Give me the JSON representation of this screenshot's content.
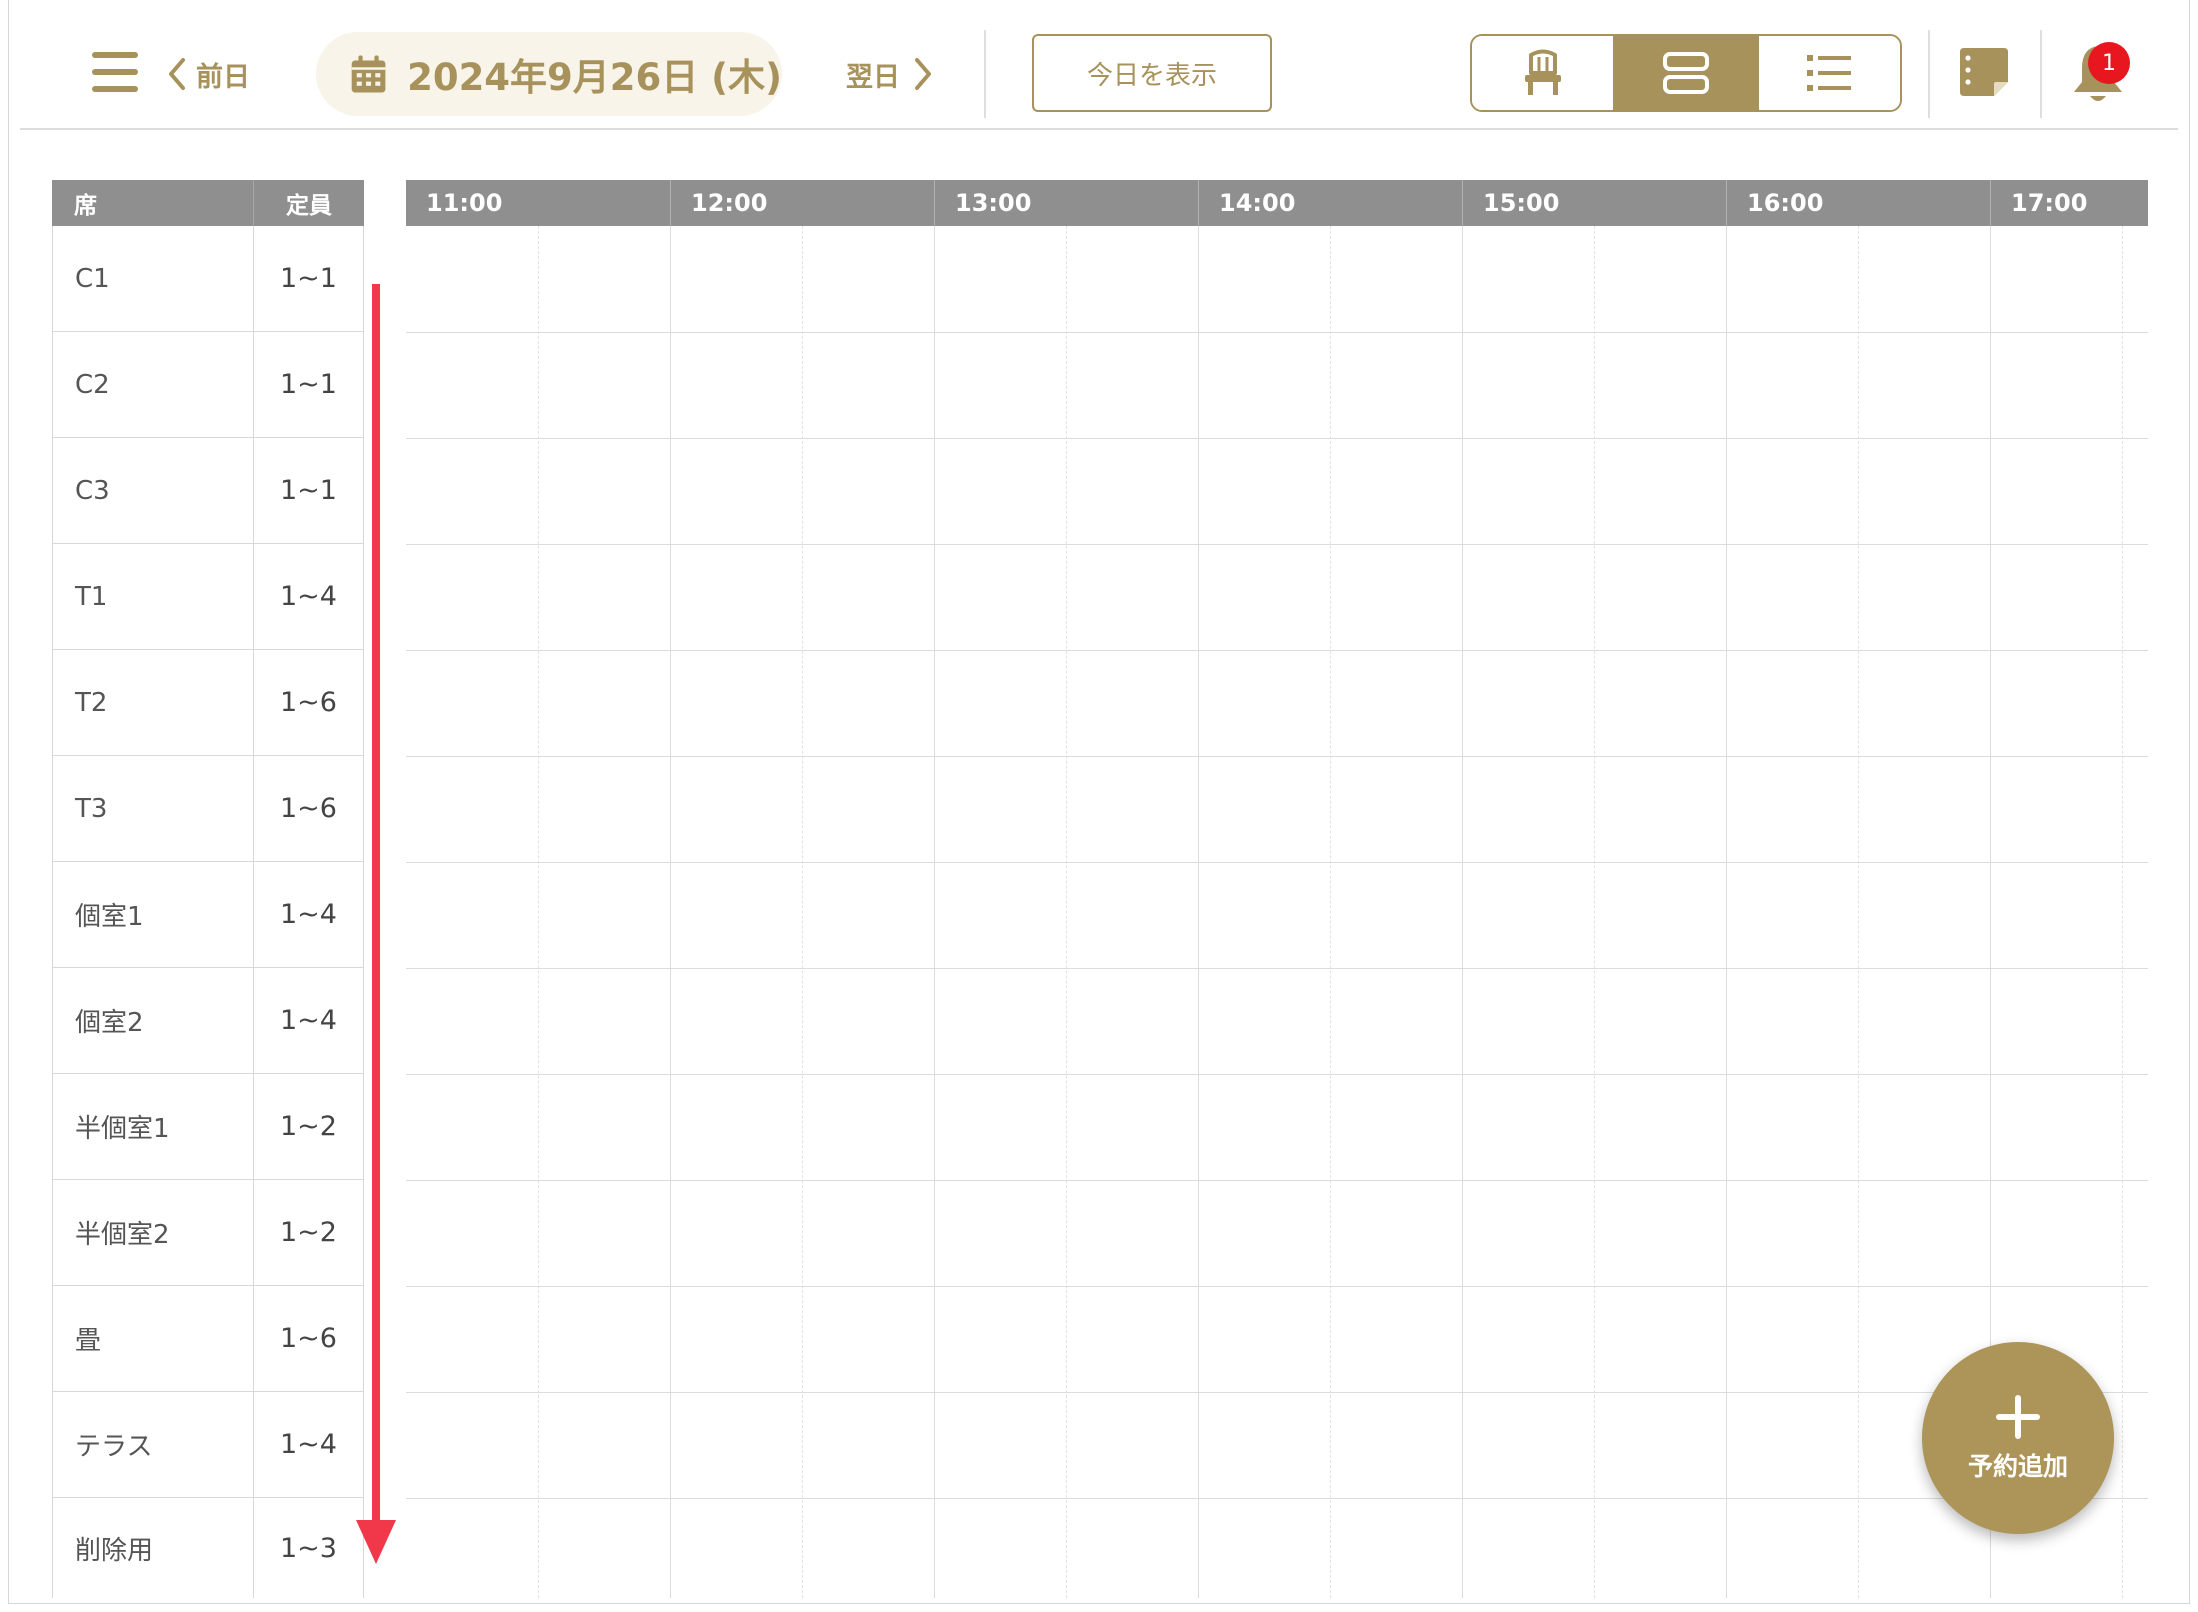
{
  "header": {
    "prev_label": "前日",
    "next_label": "翌日",
    "date": "2024年9月26日 (木)",
    "today_label": "今日を表示",
    "notification_count": "1",
    "view_modes": [
      "chair-icon",
      "timeline-icon",
      "list-icon"
    ],
    "active_view": "timeline-icon"
  },
  "seat_table": {
    "headers": {
      "seat": "席",
      "capacity": "定員"
    },
    "rows": [
      {
        "seat": "C1",
        "capacity": "1~1"
      },
      {
        "seat": "C2",
        "capacity": "1~1"
      },
      {
        "seat": "C3",
        "capacity": "1~1"
      },
      {
        "seat": "T1",
        "capacity": "1~4"
      },
      {
        "seat": "T2",
        "capacity": "1~6"
      },
      {
        "seat": "T3",
        "capacity": "1~6"
      },
      {
        "seat": "個室1",
        "capacity": "1~4"
      },
      {
        "seat": "個室2",
        "capacity": "1~4"
      },
      {
        "seat": "半個室1",
        "capacity": "1~2"
      },
      {
        "seat": "半個室2",
        "capacity": "1~2"
      },
      {
        "seat": "畳",
        "capacity": "1~6"
      },
      {
        "seat": "テラス",
        "capacity": "1~4"
      },
      {
        "seat": "削除用",
        "capacity": "1~3"
      }
    ]
  },
  "timeline": {
    "hours": [
      "11:00",
      "12:00",
      "13:00",
      "14:00",
      "15:00",
      "16:00",
      "17:00"
    ]
  },
  "fab": {
    "label": "予約追加"
  },
  "colors": {
    "accent": "#a8925b",
    "header_bg": "#8f8f8f",
    "arrow": "#f0384a",
    "badge": "#e8161e"
  }
}
